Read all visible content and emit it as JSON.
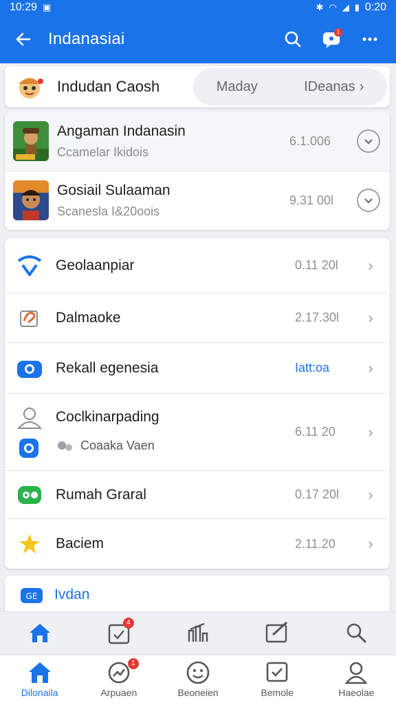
{
  "status": {
    "time_left": "10:29",
    "time_right": "0:20"
  },
  "app_bar": {
    "title": "Indanasiai",
    "notif_badge": "1"
  },
  "header": {
    "title": "Indudan Caosh",
    "pill_left": "Maday",
    "pill_right": "IDeanas"
  },
  "games": [
    {
      "title": "Angaman Indanasin",
      "subtitle": "Ccamelar Ikidois",
      "value": "6.1.006"
    },
    {
      "title": "Gosiail Sulaaman",
      "subtitle": "Scanesla I&20oois",
      "value": "9.31 00l"
    }
  ],
  "list": [
    {
      "label": "Geolaanpiar",
      "value": "0.11 20l",
      "icon": "wifi-icon"
    },
    {
      "label": "Dalmaoke",
      "value": "2.17.30l",
      "icon": "edit-icon"
    },
    {
      "label": "Rekall egenesia",
      "value": "Iatt:oa",
      "icon": "camera-icon",
      "highlight": true
    },
    {
      "label": "Coclkinarpading",
      "sub": "Coaaka Vaen",
      "value": "6.11 20",
      "icon": "user-icon"
    },
    {
      "label": "Rumah Graral",
      "value": "0.17 20l",
      "icon": "message-icon"
    },
    {
      "label": "Baciem",
      "value": "2.11.20",
      "icon": "star-icon"
    }
  ],
  "partial": {
    "label": "Ivdan"
  },
  "tabbar_badge": "4",
  "bottom_nav": [
    {
      "label": "Dilonaila",
      "icon": "home-icon",
      "active": true
    },
    {
      "label": "Arpuaen",
      "icon": "chart-icon",
      "badge": "1"
    },
    {
      "label": "Beoneien",
      "icon": "face-icon"
    },
    {
      "label": "Bemole",
      "icon": "checkbox-icon"
    },
    {
      "label": "Haeolae",
      "icon": "person-icon"
    }
  ],
  "colors": {
    "primary": "#1a73e8",
    "badge": "#e53935"
  }
}
